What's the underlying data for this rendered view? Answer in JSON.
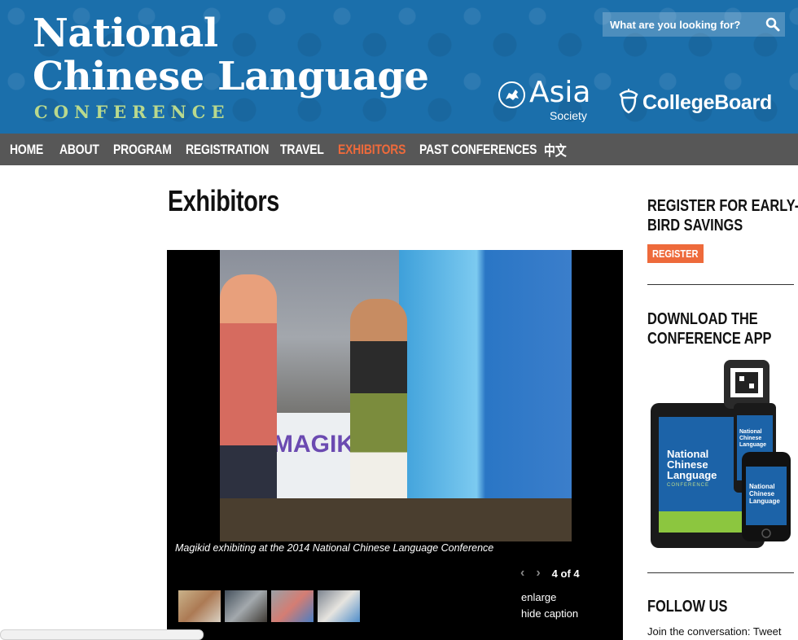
{
  "header": {
    "logo_line1": "National",
    "logo_line2": "Chinese Language",
    "logo_line3": "CONFERENCE",
    "search_placeholder": "What are you looking for?",
    "partner1_name": "Asia",
    "partner1_sub": "Society",
    "partner2_name": "CollegeBoard"
  },
  "nav": {
    "items": [
      "HOME",
      "ABOUT",
      "PROGRAM",
      "REGISTRATION",
      "TRAVEL",
      "EXHIBITORS",
      "PAST CONFERENCES",
      "中文"
    ],
    "active": "EXHIBITORS"
  },
  "main": {
    "title": "Exhibitors",
    "gallery": {
      "photo_text": "MAGIKI",
      "caption": "Magikid exhibiting at the 2014 National Chinese Language Conference",
      "pager": "4 of 4",
      "enlarge": "enlarge",
      "hide_caption": "hide caption"
    }
  },
  "sidebar": {
    "register_heading": "Register for Early-Bird Savings",
    "register_button": "REGISTER",
    "app_heading": "Download the Conference App",
    "app_screen_line1": "National",
    "app_screen_line2": "Chinese",
    "app_screen_line3": "Language",
    "app_screen_line4": "CONFERENCE",
    "follow_heading": "Follow Us",
    "follow_text": "Join the conversation: Tweet"
  },
  "colors": {
    "header_blue": "#1b6fab",
    "nav_gray": "#575757",
    "accent_orange": "#ee6a3b",
    "conference_green": "#b9d98d"
  }
}
